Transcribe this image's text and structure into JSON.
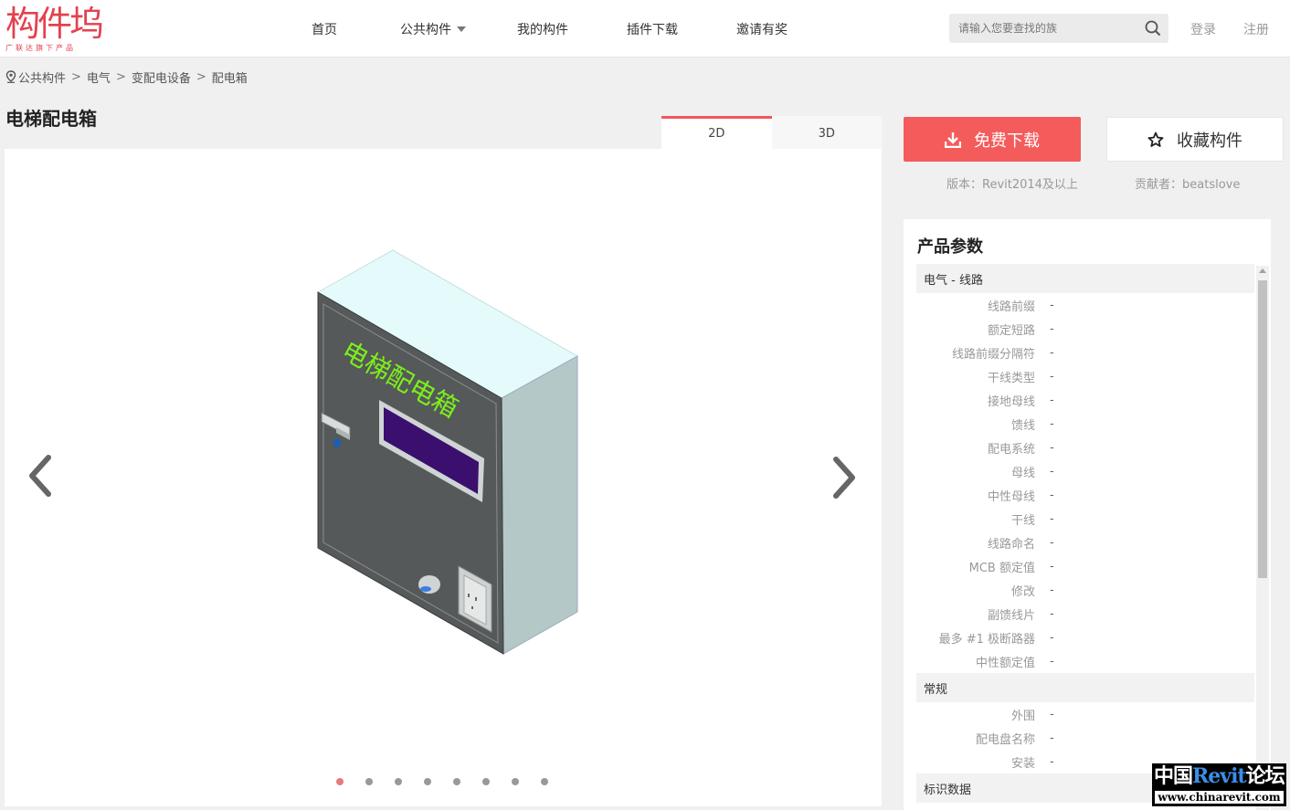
{
  "header": {
    "logo_text": "构件坞",
    "logo_sub": "广联达旗下产品",
    "nav": [
      "首页",
      "公共构件",
      "我的构件",
      "插件下载",
      "邀请有奖"
    ],
    "search_placeholder": "请输入您要查找的族",
    "login": "登录",
    "register": "注册"
  },
  "breadcrumb": [
    "公共构件",
    "电气",
    "变配电设备",
    "配电箱"
  ],
  "page_title": "电梯配电箱",
  "tabs": [
    "2D",
    "3D"
  ],
  "active_tab": "2D",
  "viewer": {
    "model_label": "电梯配电箱",
    "dots_count": 8,
    "active_dot": 0
  },
  "actions": {
    "download": "免费下载",
    "favorite": "收藏构件",
    "version": "版本：Revit2014及以上",
    "contributor": "贡献者：beatslove"
  },
  "params": {
    "title": "产品参数",
    "groups": [
      {
        "name": "电气 - 线路",
        "rows": [
          {
            "name": "线路前缀",
            "value": "-"
          },
          {
            "name": "额定短路",
            "value": "-"
          },
          {
            "name": "线路前缀分隔符",
            "value": "-"
          },
          {
            "name": "干线类型",
            "value": "-"
          },
          {
            "name": "接地母线",
            "value": "-"
          },
          {
            "name": "馈线",
            "value": "-"
          },
          {
            "name": "配电系统",
            "value": "-"
          },
          {
            "name": "母线",
            "value": "-"
          },
          {
            "name": "中性母线",
            "value": "-"
          },
          {
            "name": "干线",
            "value": "-"
          },
          {
            "name": "线路命名",
            "value": "-"
          },
          {
            "name": "MCB 额定值",
            "value": "-"
          },
          {
            "name": "修改",
            "value": "-"
          },
          {
            "name": "副馈线片",
            "value": "-"
          },
          {
            "name": "最多 #1 极断路器",
            "value": "-"
          },
          {
            "name": "中性额定值",
            "value": "-"
          }
        ]
      },
      {
        "name": "常规",
        "rows": [
          {
            "name": "外围",
            "value": "-"
          },
          {
            "name": "配电盘名称",
            "value": "-"
          },
          {
            "name": "安装",
            "value": "-"
          }
        ]
      },
      {
        "name": "标识数据",
        "rows": []
      }
    ]
  },
  "watermark": {
    "line1_a": "中国",
    "line1_b": "Revit",
    "line1_c": "论坛",
    "line2": "www.chinarevit.com"
  },
  "colors": {
    "accent": "#f45b5b",
    "cabinet_front": "#55595a",
    "cabinet_top": "#e5fbfb",
    "cabinet_side": "#b4c8c8",
    "display": "#3a0f6e",
    "label_green": "#7cf01a"
  }
}
